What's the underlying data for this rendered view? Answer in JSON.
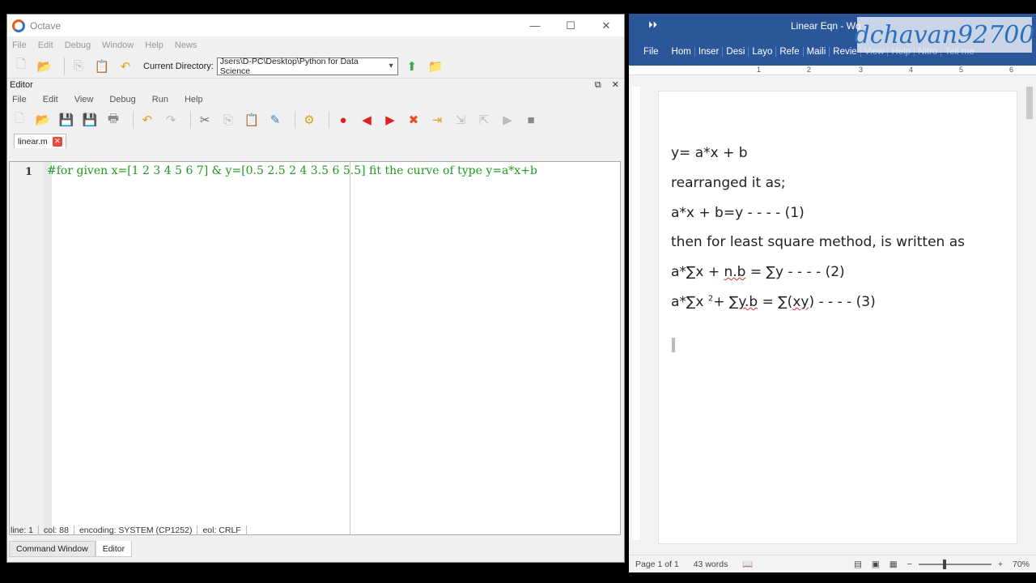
{
  "octave": {
    "title": "Octave",
    "window_controls": [
      "—",
      "☐",
      "✕"
    ],
    "menu": [
      "File",
      "Edit",
      "Debug",
      "Window",
      "Help",
      "News"
    ],
    "current_directory_label": "Current Directory:",
    "current_directory_value": "Jsers\\D-PC\\Desktop\\Python for Data Science",
    "editor_label": "Editor",
    "editor_menu": [
      "File",
      "Edit",
      "View",
      "Debug",
      "Run",
      "Help"
    ],
    "tab_name": "linear.m",
    "line_number": "1",
    "code_line": "#for given x=[1 2 3 4 5 6 7] &  y=[0.5 2.5 2 4 3.5 6 5.5] fit the curve of type y=a*x+b",
    "status": {
      "line": "line: 1",
      "col": "col: 88",
      "encoding": "encoding: SYSTEM (CP1252)",
      "eol": "eol: CRLF"
    },
    "bottom_tabs": [
      "Command Window",
      "Editor"
    ]
  },
  "word": {
    "title": "Linear Eqn  -  Wo",
    "watermark": "dchavan92700",
    "ribbon_tabs": [
      "Hom",
      "Inser",
      "Desi",
      "Layo",
      "Refe",
      "Maili",
      "Revie",
      "View",
      "Help",
      "Nitro",
      "Tell me"
    ],
    "file_tab": "File",
    "ruler_numbers": [
      "1",
      "2",
      "3",
      "4",
      "5",
      "6"
    ],
    "doc_lines": {
      "l1": "y= a*x + b",
      "l2": "rearranged it as;",
      "l3": "a*x + b=y - - - - (1)",
      "l4": "then for least square method, is written as",
      "l5a": "a*∑x + ",
      "l5b": "n.b",
      "l5c": " = ∑y - - - - (2)",
      "l6a": "a*∑x ",
      "l6sup": "2",
      "l6b": "+ ",
      "l6c": "∑y.b",
      "l6d": " = ∑(",
      "l6e": "xy",
      "l6f": ") - - - - (3)"
    },
    "status": {
      "page": "Page 1 of 1",
      "words": "43 words",
      "zoom": "70%"
    }
  }
}
